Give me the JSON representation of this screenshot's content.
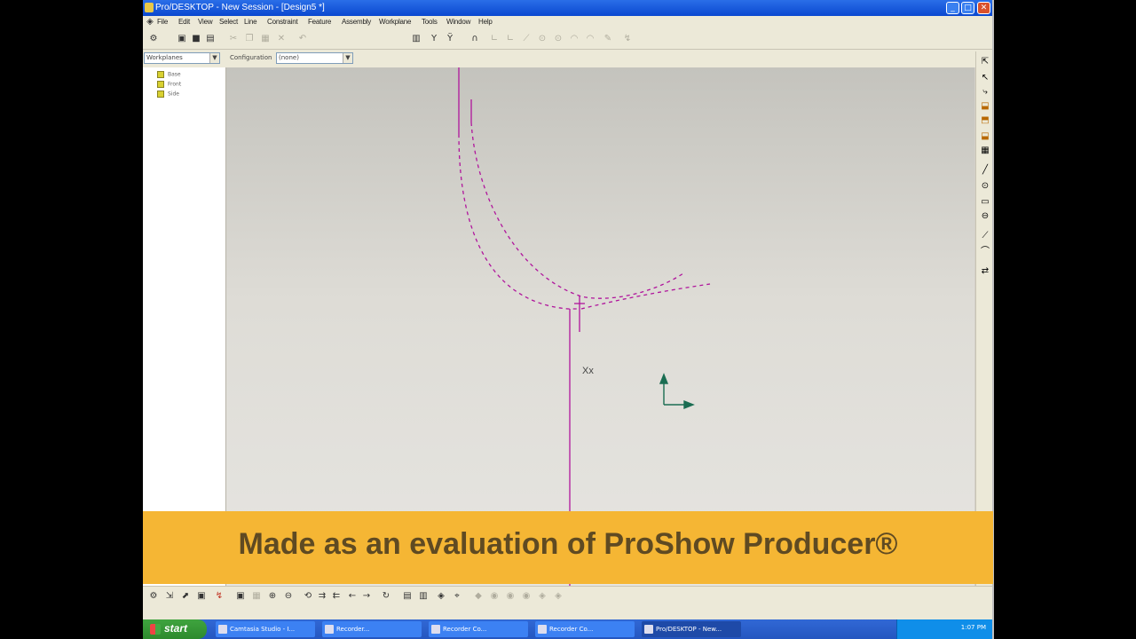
{
  "window": {
    "title": "Pro/DESKTOP - New Session - [Design5 *]",
    "min_label": "_",
    "max_label": "□",
    "close_label": "✕"
  },
  "menu": [
    "File",
    "Edit",
    "View",
    "Select",
    "Line",
    "Constraint",
    "Feature",
    "Assembly",
    "Workplane",
    "Tools",
    "Window",
    "Help"
  ],
  "toolbar2": {
    "browser_combo": "Workplanes",
    "config_label": "Configuration",
    "config_combo": "(none)"
  },
  "tree": {
    "items": [
      "Base",
      "Front",
      "Side"
    ]
  },
  "sketch": {
    "line_color": "#b0149c",
    "axis_color": "#1a6d52",
    "cursor_label": "Xx"
  },
  "taskbar": {
    "start_label": "start",
    "tasks": [
      "Camtasia Studio - I...",
      "Recorder...",
      "Recorder Co...",
      "Recorder Co...",
      "Pro/DESKTOP - New..."
    ],
    "clock": "1:07 PM"
  },
  "banner": {
    "text": "Made as an evaluation of ProShow Producer®"
  },
  "colors": {
    "banner_bg": "#f5b634",
    "banner_text": "#5f4a22",
    "titlebar": "#0a48d0",
    "canvas_bg": "#dedcd6"
  }
}
